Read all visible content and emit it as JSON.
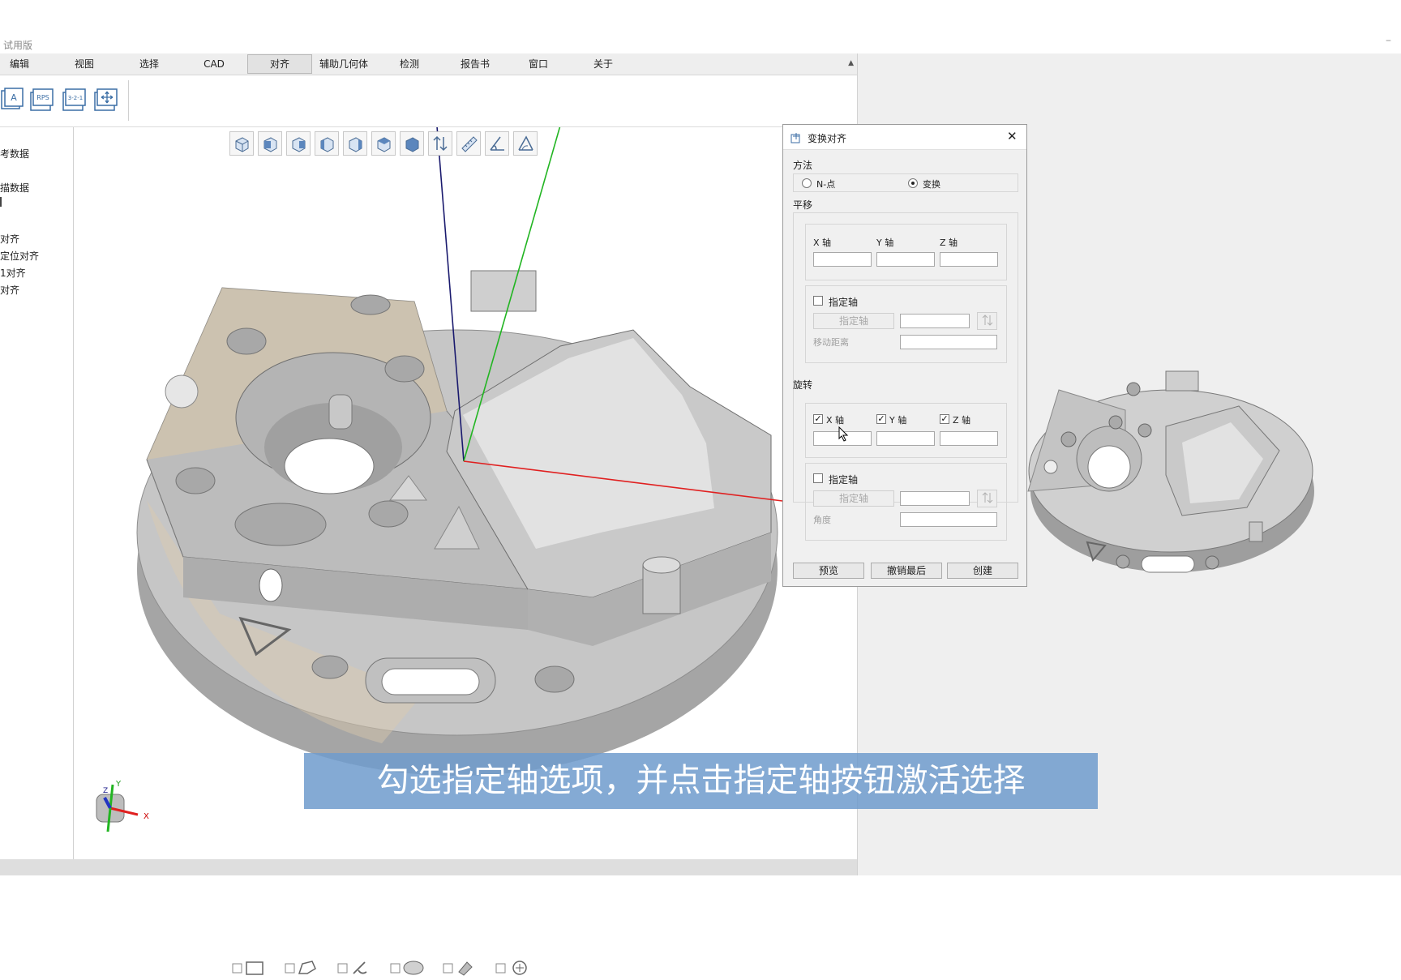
{
  "window": {
    "trial_label": "试用版",
    "minimize_glyph": "–"
  },
  "menubar": {
    "items": [
      "编辑",
      "视图",
      "选择",
      "CAD",
      "对齐",
      "辅助几何体",
      "检测",
      "报告书",
      "窗口",
      "关于"
    ],
    "active": "对齐",
    "collapse_glyph": "▲"
  },
  "ribbon": {
    "buttons": [
      {
        "icon": "best-fit-align-icon",
        "text": "A"
      },
      {
        "icon": "rps-align-icon",
        "text": "RPS"
      },
      {
        "icon": "three-two-one-align-icon",
        "text": "3-2-1"
      },
      {
        "icon": "transform-align-icon",
        "text": ""
      }
    ]
  },
  "tree": {
    "items": [
      "考数据",
      "描数据",
      "",
      "对齐",
      "定位对齐",
      "1对齐",
      "对齐"
    ],
    "collapse_glyph": "◀"
  },
  "view_toolbar": {
    "icons": [
      "view-iso-icon",
      "view-front-icon",
      "view-back-icon",
      "view-left-icon",
      "view-right-icon",
      "view-top-icon",
      "view-bottom-icon",
      "flip-view-icon",
      "measure-icon",
      "angle-icon",
      "section-view-icon"
    ]
  },
  "axes": {
    "x_color": "#e02020",
    "y_color": "#22b522",
    "z_color": "#1a1a6e"
  },
  "dialog": {
    "title": "变换对齐",
    "method_label": "方法",
    "methods": [
      {
        "label": "N-点",
        "selected": false
      },
      {
        "label": "变换",
        "selected": true
      }
    ],
    "translate": {
      "label": "平移",
      "axis_labels": [
        "X 轴",
        "Y 轴",
        "Z 轴"
      ],
      "values": [
        "",
        "",
        ""
      ],
      "specify_axis_checkbox": {
        "label": "指定轴",
        "checked": false
      },
      "specify_axis_button": "指定轴",
      "specify_axis_value": "",
      "move_distance_label": "移动距离",
      "move_distance_value": ""
    },
    "rotate": {
      "label": "旋转",
      "axis_checks": [
        {
          "label": "X 轴",
          "checked": true
        },
        {
          "label": "Y 轴",
          "checked": true
        },
        {
          "label": "Z 轴",
          "checked": true
        }
      ],
      "values": [
        "",
        "",
        ""
      ],
      "specify_axis_checkbox": {
        "label": "指定轴",
        "checked": false
      },
      "specify_axis_button": "指定轴",
      "specify_axis_value": "",
      "angle_label": "角度",
      "angle_value": ""
    },
    "buttons": {
      "preview": "预览",
      "undo_last": "撤销最后",
      "create": "创建"
    },
    "close_glyph": "✕"
  },
  "subtitle": "勾选指定轴选项，并点击指定轴按钮激活选择",
  "triad": {
    "x": "X",
    "y": "Y",
    "z": "Z"
  },
  "selection_tools": [
    "rect-select-icon",
    "polygon-select-icon",
    "brush-select-icon",
    "surface-select-icon",
    "paint-select-icon",
    "point-select-icon"
  ],
  "colors": {
    "accent_subtitle": "#6e9bcd",
    "model_gray": "#bdbdbd",
    "model_tan": "#dcc8aa"
  }
}
